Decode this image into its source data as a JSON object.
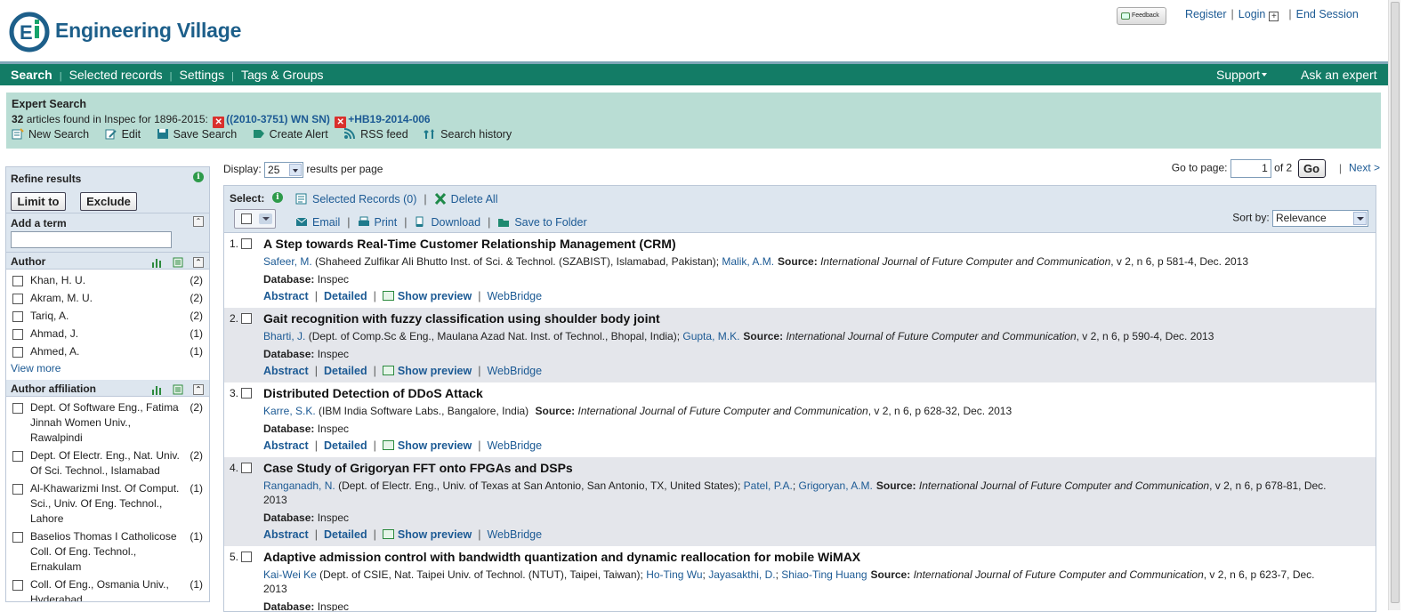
{
  "header": {
    "logo_text": "Engineering Village",
    "feedback_label": "Feedback",
    "links": {
      "register": "Register",
      "login": "Login",
      "end_session": "End Session"
    },
    "login_plus": "+"
  },
  "nav": {
    "items": [
      "Search",
      "Selected records",
      "Settings",
      "Tags & Groups"
    ],
    "support": "Support",
    "ask": "Ask an expert"
  },
  "search_info": {
    "title": "Expert Search",
    "count": "32",
    "count_text": " articles found in Inspec for 1896-2015: ",
    "terms": [
      "((2010-3751) WN SN)",
      "+HB19-2014-006"
    ],
    "actions": [
      "New Search",
      "Edit",
      "Save Search",
      "Create Alert",
      "RSS feed",
      "Search history"
    ]
  },
  "sidebar": {
    "refine_title": "Refine results",
    "limit_label": "Limit to",
    "exclude_label": "Exclude",
    "add_term_label": "Add a term",
    "author_title": "Author",
    "authors": [
      {
        "name": "Khan, H. U.",
        "count": "(2)"
      },
      {
        "name": "Akram, M. U.",
        "count": "(2)"
      },
      {
        "name": "Tariq, A.",
        "count": "(2)"
      },
      {
        "name": "Ahmad, J.",
        "count": "(1)"
      },
      {
        "name": "Ahmed, A.",
        "count": "(1)"
      }
    ],
    "view_more": "View more",
    "affiliation_title": "Author affiliation",
    "affiliations": [
      {
        "name": "Dept. Of Software Eng., Fatima Jinnah Women Univ., Rawalpindi",
        "count": "(2)"
      },
      {
        "name": "Dept. Of Electr. Eng., Nat. Univ. Of Sci. Technol., Islamabad",
        "count": "(2)"
      },
      {
        "name": "Al-Khawarizmi Inst. Of Comput. Sci., Univ. Of Eng. Technol., Lahore",
        "count": "(1)"
      },
      {
        "name": "Baselios Thomas I Catholicose Coll. Of Eng. Technol., Ernakulam",
        "count": "(1)"
      },
      {
        "name": "Coll. Of Eng., Osmania Univ., Hyderabad",
        "count": "(1)"
      }
    ]
  },
  "main": {
    "display_label": "Display:",
    "per_page": "25",
    "per_page_suffix": "results per page",
    "goto_label": "Go to page:",
    "page_value": "1",
    "of_pages": "of 2",
    "go_label": "Go",
    "next_label": "Next >",
    "select_label": "Select:",
    "selected_records": "Selected Records (0)",
    "delete_all": "Delete All",
    "email": "Email",
    "print": "Print",
    "download": "Download",
    "save_folder": "Save to Folder",
    "sort_label": "Sort by:",
    "sort_value": "Relevance",
    "db_label": "Database:",
    "source_label": "Source:",
    "link_abstract": "Abstract",
    "link_detailed": "Detailed",
    "link_preview": "Show preview",
    "link_webbridge": "WebBridge"
  },
  "results": [
    {
      "num": "1.",
      "title": "A Step towards Real-Time Customer Relationship Management (CRM)",
      "authors": [
        {
          "name": "Safeer, M.",
          "aff": " (Shaheed Zulfikar Ali Bhutto Inst. of Sci. & Technol. (SZABIST), Islamabad, Pakistan); "
        },
        {
          "name": "Malik, A.M.",
          "aff": ""
        }
      ],
      "journal": "International Journal of Future Computer and Communication",
      "citation": ", v 2, n 6, p 581-4, Dec. 2013",
      "database": "Inspec"
    },
    {
      "num": "2.",
      "title": "Gait recognition with fuzzy classification using shoulder body joint",
      "authors": [
        {
          "name": "Bharti, J.",
          "aff": " (Dept. of Comp.Sc & Eng., Maulana Azad Nat. Inst. of Technol., Bhopal, India); "
        },
        {
          "name": "Gupta, M.K.",
          "aff": ""
        }
      ],
      "journal": "International Journal of Future Computer and Communication",
      "citation": ", v 2, n 6, p 590-4, Dec. 2013",
      "database": "Inspec"
    },
    {
      "num": "3.",
      "title": "Distributed Detection of DDoS Attack",
      "authors": [
        {
          "name": "Karre, S.K.",
          "aff": " (IBM India Software Labs., Bangalore, India) "
        }
      ],
      "journal": "International Journal of Future Computer and Communication",
      "citation": ", v 2, n 6, p 628-32, Dec. 2013",
      "database": "Inspec"
    },
    {
      "num": "4.",
      "title": "Case Study of Grigoryan FFT onto FPGAs and DSPs",
      "authors": [
        {
          "name": "Ranganadh, N.",
          "aff": " (Dept. of Electr. Eng., Univ. of Texas at San Antonio, San Antonio, TX, United States); "
        },
        {
          "name": "Patel, P.A.",
          "aff": "; "
        },
        {
          "name": "Grigoryan, A.M.",
          "aff": ""
        }
      ],
      "journal": "International Journal of Future Computer and Communication",
      "citation": ", v 2, n 6, p 678-81, Dec. 2013",
      "database": "Inspec"
    },
    {
      "num": "5.",
      "title": "Adaptive admission control with bandwidth quantization and dynamic reallocation for mobile WiMAX",
      "authors": [
        {
          "name": "Kai-Wei Ke",
          "aff": " (Dept. of CSIE, Nat. Taipei Univ. of Technol. (NTUT), Taipei, Taiwan); "
        },
        {
          "name": "Ho-Ting Wu",
          "aff": "; "
        },
        {
          "name": "Jayasakthi, D.",
          "aff": "; "
        },
        {
          "name": "Shiao-Ting Huang",
          "aff": ""
        }
      ],
      "journal": "International Journal of Future Computer and Communication",
      "citation": ", v 2, n 6, p 623-7, Dec. 2013",
      "database": "Inspec"
    }
  ],
  "colors": {
    "nav_green": "#137c66",
    "search_panel": "#b9ddd4",
    "link_blue": "#1c5a94",
    "panel_blue": "#dde6ef"
  }
}
